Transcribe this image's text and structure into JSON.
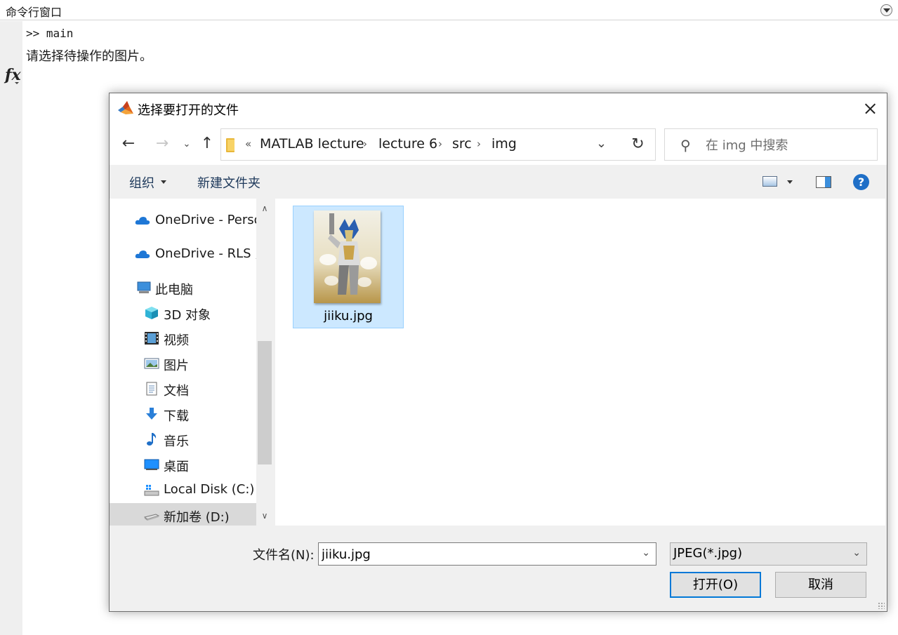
{
  "command_window": {
    "title": "命令行窗口",
    "prompt_line": ">> main",
    "output_line": "请选择待操作的图片。",
    "fx_label": "fx"
  },
  "dialog": {
    "title": "选择要打开的文件",
    "nav": {
      "back_icon": "←",
      "forward_icon": "→",
      "recent_icon": "⌄",
      "up_icon": "↑"
    },
    "address": {
      "overflow_chevron": "«",
      "separator": "›",
      "segments": [
        "MATLAB lecture",
        "lecture 6",
        "src",
        "img"
      ],
      "dropdown_icon": "⌄",
      "refresh_icon": "↻"
    },
    "search": {
      "icon": "⚲",
      "placeholder": "在 img 中搜索"
    },
    "toolbar": {
      "organize": "组织",
      "new_folder": "新建文件夹",
      "help": "?"
    },
    "nav_pane": {
      "items": [
        {
          "label": "OneDrive - Personal",
          "icon": "cloud-icon"
        },
        {
          "label": "OneDrive - RLS ,i",
          "icon": "cloud-icon"
        },
        {
          "label": "此电脑",
          "icon": "computer-icon"
        },
        {
          "label": "3D 对象",
          "icon": "3d-objects-icon"
        },
        {
          "label": "视频",
          "icon": "video-icon"
        },
        {
          "label": "图片",
          "icon": "pictures-icon"
        },
        {
          "label": "文档",
          "icon": "documents-icon"
        },
        {
          "label": "下载",
          "icon": "download-icon"
        },
        {
          "label": "音乐",
          "icon": "music-icon"
        },
        {
          "label": "桌面",
          "icon": "desktop-icon"
        },
        {
          "label": "Local Disk (C:)",
          "icon": "windows-drive-icon"
        },
        {
          "label": "新加卷 (D:)",
          "icon": "drive-icon"
        }
      ],
      "selected_index": 11,
      "scroll_up": "∧",
      "scroll_down": "∨"
    },
    "files": [
      {
        "name": "jiiku.jpg",
        "selected": true
      }
    ],
    "footer": {
      "filename_label": "文件名(N):",
      "filename_value": "jiiku.jpg",
      "filetype_value": "JPEG(*.jpg)",
      "dropdown_icon": "⌄",
      "open_button": "打开(O)",
      "cancel_button": "取消"
    }
  }
}
